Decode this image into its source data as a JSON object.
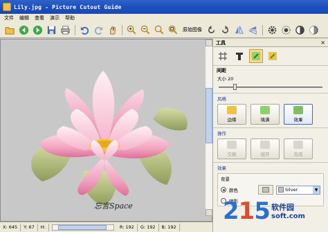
{
  "window": {
    "title": "Lily.jpg - Picture Cutout Guide"
  },
  "menu": [
    "文件",
    "编辑",
    "查看",
    "演示",
    "帮助"
  ],
  "toolbar": {
    "original_image_label": "原始图像"
  },
  "canvas": {
    "signature": "忘言Space"
  },
  "status": {
    "x": "X: 645",
    "y": "Y: 67",
    "h": "H:",
    "r": "R: 192",
    "g": "G: 192",
    "b": "B: 192"
  },
  "panel": {
    "title": "工具",
    "close": "×",
    "spacing_label": "间距",
    "size_label": "大小 20",
    "size_value": 20,
    "style_group": "风格",
    "style_buttons": [
      "边缘",
      "填满",
      "效果"
    ],
    "action_group": "操作",
    "action_buttons": [
      "交换",
      "储存",
      "完成"
    ],
    "effects_group": "效果",
    "background_label": "背景",
    "color_label": "颜色",
    "color_value": "Silver",
    "shadow_label": "阴影"
  },
  "watermark": {
    "digits": "2",
    "digits2": "1",
    "digits3": "5",
    "text": "软件园",
    "url": "soft.com"
  },
  "colors": {
    "title_bar": "#1d4fbf",
    "canvas_bg": "#c8c8c8",
    "silver": "#c0c0c0",
    "active_tool": "#f7d98c"
  }
}
